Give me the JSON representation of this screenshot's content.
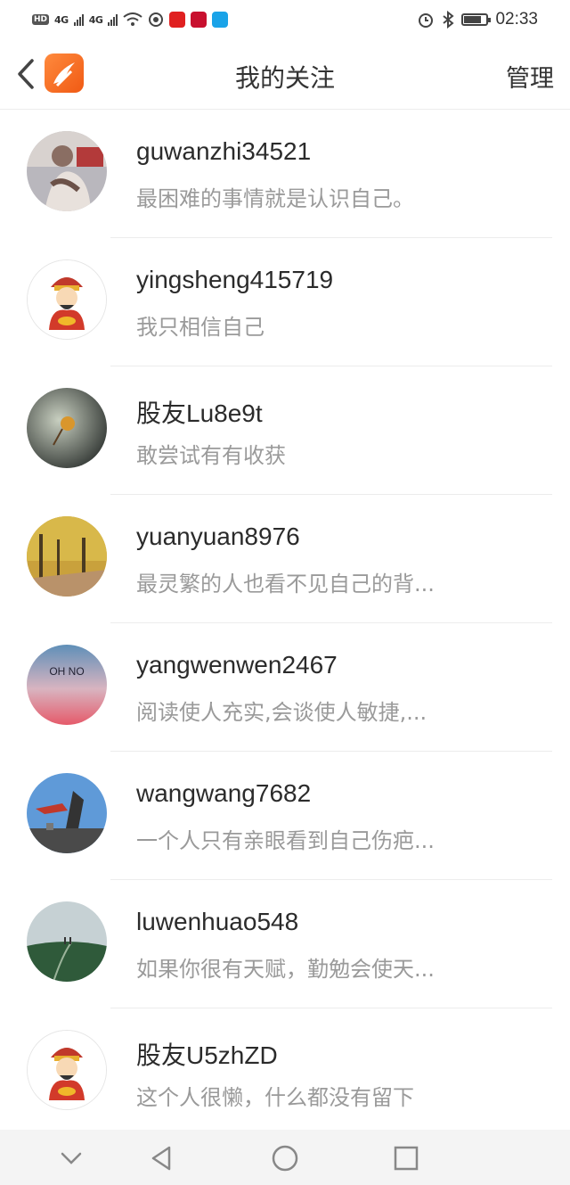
{
  "status_bar": {
    "time": "02:33",
    "network_1": "4G",
    "network_2": "4G",
    "hd": "HD"
  },
  "header": {
    "title": "我的关注",
    "manage_label": "管理"
  },
  "follows": [
    {
      "name": "guwanzhi34521",
      "bio": "最困难的事情就是认识自己。"
    },
    {
      "name": "yingsheng415719",
      "bio": "我只相信自己"
    },
    {
      "name": "股友Lu8e9t",
      "bio": "敢尝试有有收获"
    },
    {
      "name": "yuanyuan8976",
      "bio": "最灵繁的人也看不见自己的背..."
    },
    {
      "name": "yangwenwen2467",
      "bio": "阅读使人充实,会谈使人敏捷,..."
    },
    {
      "name": "wangwang7682",
      "bio": "一个人只有亲眼看到自己伤疤..."
    },
    {
      "name": "luwenhuao548",
      "bio": "如果你很有天赋，勤勉会使天..."
    },
    {
      "name": "股友U5zhZD",
      "bio": "这个人很懒，什么都没有留下"
    }
  ],
  "avatar_text": {
    "oh_no": "OH NO"
  },
  "icons": {
    "back": "chevron-left-icon",
    "logo": "app-logo-icon",
    "nav_down": "chevron-down-icon",
    "nav_back": "triangle-back-icon",
    "nav_home": "circle-home-icon",
    "nav_recent": "square-recent-icon"
  },
  "colors": {
    "accent": "#f26522",
    "text": "#2b2b2b",
    "subtext": "#9a9a9a",
    "divider": "#ececec"
  }
}
